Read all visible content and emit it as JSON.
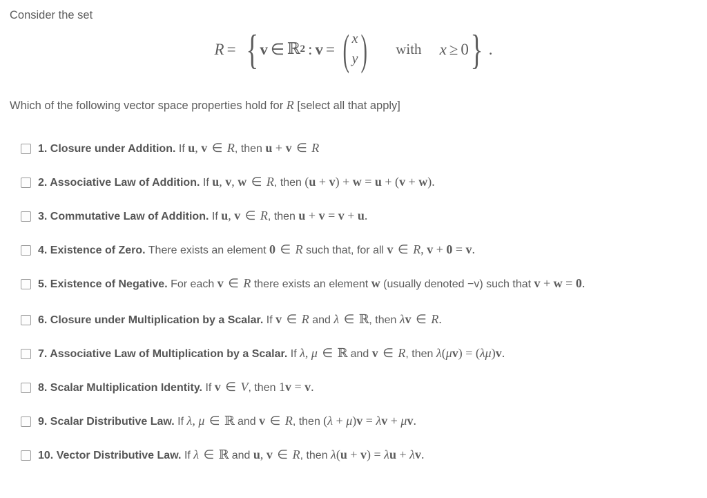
{
  "intro": {
    "text": "Consider the set"
  },
  "formula": {
    "set_name": "R",
    "equals": "=",
    "brace_open": "{",
    "brace_close": "}",
    "vector_symbol": "v",
    "element_of": "∈",
    "domain": "ℝ",
    "domain_exponent": "2",
    "colon": ":",
    "component_x": "x",
    "component_y": "y",
    "with_word": "with",
    "condition_var": "x",
    "condition_rel": "≥",
    "condition_value": "0",
    "trailing_period": "."
  },
  "question": {
    "prefix": "Which of the following vector space properties hold for",
    "set_name": "R",
    "suffix": "[select all that apply]"
  },
  "options": [
    {
      "number": "1.",
      "title": "Closure under Addition.",
      "body_parts": [
        {
          "kind": "text",
          "value": "If"
        },
        {
          "kind": "math",
          "value": "u, v ∈ R"
        },
        {
          "kind": "text",
          "value": ", then"
        },
        {
          "kind": "math",
          "value": "u + v ∈ R"
        }
      ],
      "plain": "1. Closure under Addition. If u, v ∈ R, then u + v ∈ R",
      "checked": false
    },
    {
      "number": "2.",
      "title": "Associative Law of Addition.",
      "body_parts": [
        {
          "kind": "text",
          "value": "If"
        },
        {
          "kind": "math",
          "value": "u, v, w ∈ R"
        },
        {
          "kind": "text",
          "value": ", then"
        },
        {
          "kind": "math",
          "value": "(u + v) + w = u + (v + w)."
        }
      ],
      "plain": "2. Associative Law of Addition. If u, v, w ∈ R, then (u + v) + w = u + (v + w).",
      "checked": false
    },
    {
      "number": "3.",
      "title": "Commutative Law of Addition.",
      "body_parts": [
        {
          "kind": "text",
          "value": "If"
        },
        {
          "kind": "math",
          "value": "u, v ∈ R"
        },
        {
          "kind": "text",
          "value": ", then"
        },
        {
          "kind": "math",
          "value": "u + v = v + u."
        }
      ],
      "plain": "3. Commutative Law of Addition. If u, v ∈ R, then u + v = v + u.",
      "checked": false
    },
    {
      "number": "4.",
      "title": "Existence of Zero.",
      "body_parts": [
        {
          "kind": "text",
          "value": "There exists an element"
        },
        {
          "kind": "math",
          "value": "0 ∈ R"
        },
        {
          "kind": "text",
          "value": "such that, for all"
        },
        {
          "kind": "math",
          "value": "v ∈ R, v + 0 = v."
        }
      ],
      "plain": "4. Existence of Zero. There exists an element 0 ∈ R such that, for all v ∈ R, v + 0 = v.",
      "checked": false
    },
    {
      "number": "5.",
      "title": "Existence of Negative.",
      "body_parts": [
        {
          "kind": "text",
          "value": "For each"
        },
        {
          "kind": "math",
          "value": "v ∈ R"
        },
        {
          "kind": "text",
          "value": "there exists an element"
        },
        {
          "kind": "math",
          "value": "w"
        },
        {
          "kind": "text",
          "value": "(usually denoted −v) such that"
        },
        {
          "kind": "math",
          "value": "v + w = 0."
        }
      ],
      "plain": "5. Existence of Negative. For each v ∈ R there exists an element w (usually denoted −v) such that v + w = 0.",
      "checked": false
    },
    {
      "number": "6.",
      "title": "Closure under Multiplication by a Scalar.",
      "body_parts": [
        {
          "kind": "text",
          "value": "If"
        },
        {
          "kind": "math",
          "value": "v ∈ R"
        },
        {
          "kind": "text",
          "value": "and"
        },
        {
          "kind": "math",
          "value": "λ ∈ ℝ"
        },
        {
          "kind": "text",
          "value": ", then"
        },
        {
          "kind": "math",
          "value": "λv ∈ R."
        }
      ],
      "plain": "6. Closure under Multiplication by a Scalar. If v ∈ R and λ ∈ ℝ, then λv ∈ R.",
      "checked": false
    },
    {
      "number": "7.",
      "title": "Associative Law of Multiplication by a Scalar.",
      "body_parts": [
        {
          "kind": "text",
          "value": "If"
        },
        {
          "kind": "math",
          "value": "λ, μ ∈ ℝ"
        },
        {
          "kind": "text",
          "value": "and"
        },
        {
          "kind": "math",
          "value": "v ∈ R"
        },
        {
          "kind": "text",
          "value": ", then"
        },
        {
          "kind": "math",
          "value": "λ(μv) = (λμ)v."
        }
      ],
      "plain": "7. Associative Law of Multiplication by a Scalar. If λ, μ ∈ ℝ and v ∈ R, then λ(μv) = (λμ)v.",
      "checked": false
    },
    {
      "number": "8.",
      "title": "Scalar Multiplication Identity.",
      "body_parts": [
        {
          "kind": "text",
          "value": "If"
        },
        {
          "kind": "math",
          "value": "v ∈ V"
        },
        {
          "kind": "text",
          "value": ", then"
        },
        {
          "kind": "math",
          "value": "1v = v."
        }
      ],
      "plain": "8. Scalar Multiplication Identity. If v ∈ V, then 1v = v.",
      "checked": false
    },
    {
      "number": "9.",
      "title": "Scalar Distributive Law.",
      "body_parts": [
        {
          "kind": "text",
          "value": "If"
        },
        {
          "kind": "math",
          "value": "λ, μ ∈ ℝ"
        },
        {
          "kind": "text",
          "value": "and"
        },
        {
          "kind": "math",
          "value": "v ∈ R"
        },
        {
          "kind": "text",
          "value": ", then"
        },
        {
          "kind": "math",
          "value": "(λ + μ)v = λv + μv."
        }
      ],
      "plain": "9. Scalar Distributive Law. If λ, μ ∈ ℝ and v ∈ R, then (λ + μ)v = λv + μv.",
      "checked": false
    },
    {
      "number": "10.",
      "title": "Vector Distributive Law.",
      "body_parts": [
        {
          "kind": "text",
          "value": "If"
        },
        {
          "kind": "math",
          "value": "λ ∈ ℝ"
        },
        {
          "kind": "text",
          "value": "and"
        },
        {
          "kind": "math",
          "value": "u, v ∈ R"
        },
        {
          "kind": "text",
          "value": ", then"
        },
        {
          "kind": "math",
          "value": "λ(u + v) = λu + λv."
        }
      ],
      "plain": "10. Vector Distributive Law. If λ ∈ ℝ and u, v ∈ R, then λ(u + v) = λu + λv.",
      "checked": false
    }
  ],
  "colors": {
    "text": "#5c5c5c",
    "heading": "#555555",
    "checkbox_border": "#9a9a9a",
    "background": "#ffffff"
  }
}
